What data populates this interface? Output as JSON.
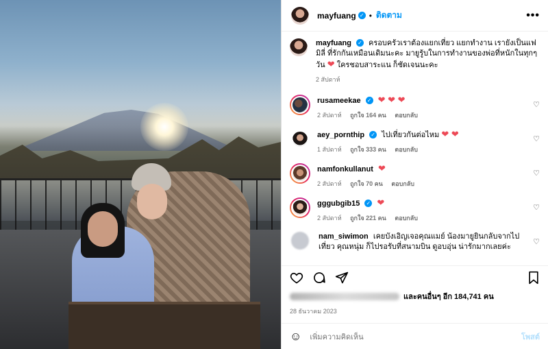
{
  "header": {
    "username": "mayfuang",
    "separator": "•",
    "follow_label": "ติดตาม",
    "more_label": "•••"
  },
  "caption": {
    "username": "mayfuang",
    "text": "ครอบครัวเราต้องแยกเที่ยว แยกทำงาน เรายังเป็นแฟมิลี่ ที่รักกันเหมือนเดิมนะคะ มายูรู้บในการทำงานของพ่อที่หนักในทุกๆวัน",
    "text_end": "ใครชอบสาระแน ก็ชัดเจนนะคะ",
    "time": "2 สัปดาห์"
  },
  "comments": [
    {
      "username": "rusameekae",
      "text": "",
      "hearts": "❤ ❤ ❤",
      "time": "2 สัปดาห์",
      "likes": "ถูกใจ 164 คน",
      "reply": "ตอบกลับ",
      "verified": true
    },
    {
      "username": "aey_pornthip",
      "text": "ไปเที่ยวกันต่อไหม",
      "hearts": "❤ ❤",
      "time": "1 สัปดาห์",
      "likes": "ถูกใจ 333 คน",
      "reply": "ตอบกลับ",
      "verified": true
    },
    {
      "username": "namfonkullanut",
      "text": "",
      "hearts": "❤",
      "time": "2 สัปดาห์",
      "likes": "ถูกใจ 70 คน",
      "reply": "ตอบกลับ",
      "verified": false
    },
    {
      "username": "gggubgib15",
      "text": "",
      "hearts": "❤",
      "time": "2 สัปดาห์",
      "likes": "ถูกใจ 221 คน",
      "reply": "ตอบกลับ",
      "verified": true
    },
    {
      "username": "nam_siwimon",
      "text": "เคยบังเอิญเจอคุณแมย์ น้องมายูยินกลับจากไปเที่ยว คุณหนุ่ม ก็ไปรอรับที่สนามบิน ดูอบอุ่น น่ารักมากเลยค่ะ",
      "hearts": "",
      "time": "",
      "likes": "",
      "reply": "",
      "verified": false
    }
  ],
  "likes_summary": {
    "suffix": "และคนอื่นๆ อีก 184,741 คน"
  },
  "post_date": "28 ธันวาคม 2023",
  "comment_box": {
    "placeholder": "เพิ่มความคิดเห็น",
    "post_label": "โพสต์"
  },
  "icons": {
    "verified": "verified-badge-icon",
    "like": "heart-outline-icon",
    "comment": "comment-bubble-icon",
    "share": "paper-plane-icon",
    "save": "bookmark-icon",
    "emoji": "smiley-icon"
  },
  "colors": {
    "accent": "#0095f6",
    "heart": "#ed4956",
    "muted": "#737373"
  }
}
